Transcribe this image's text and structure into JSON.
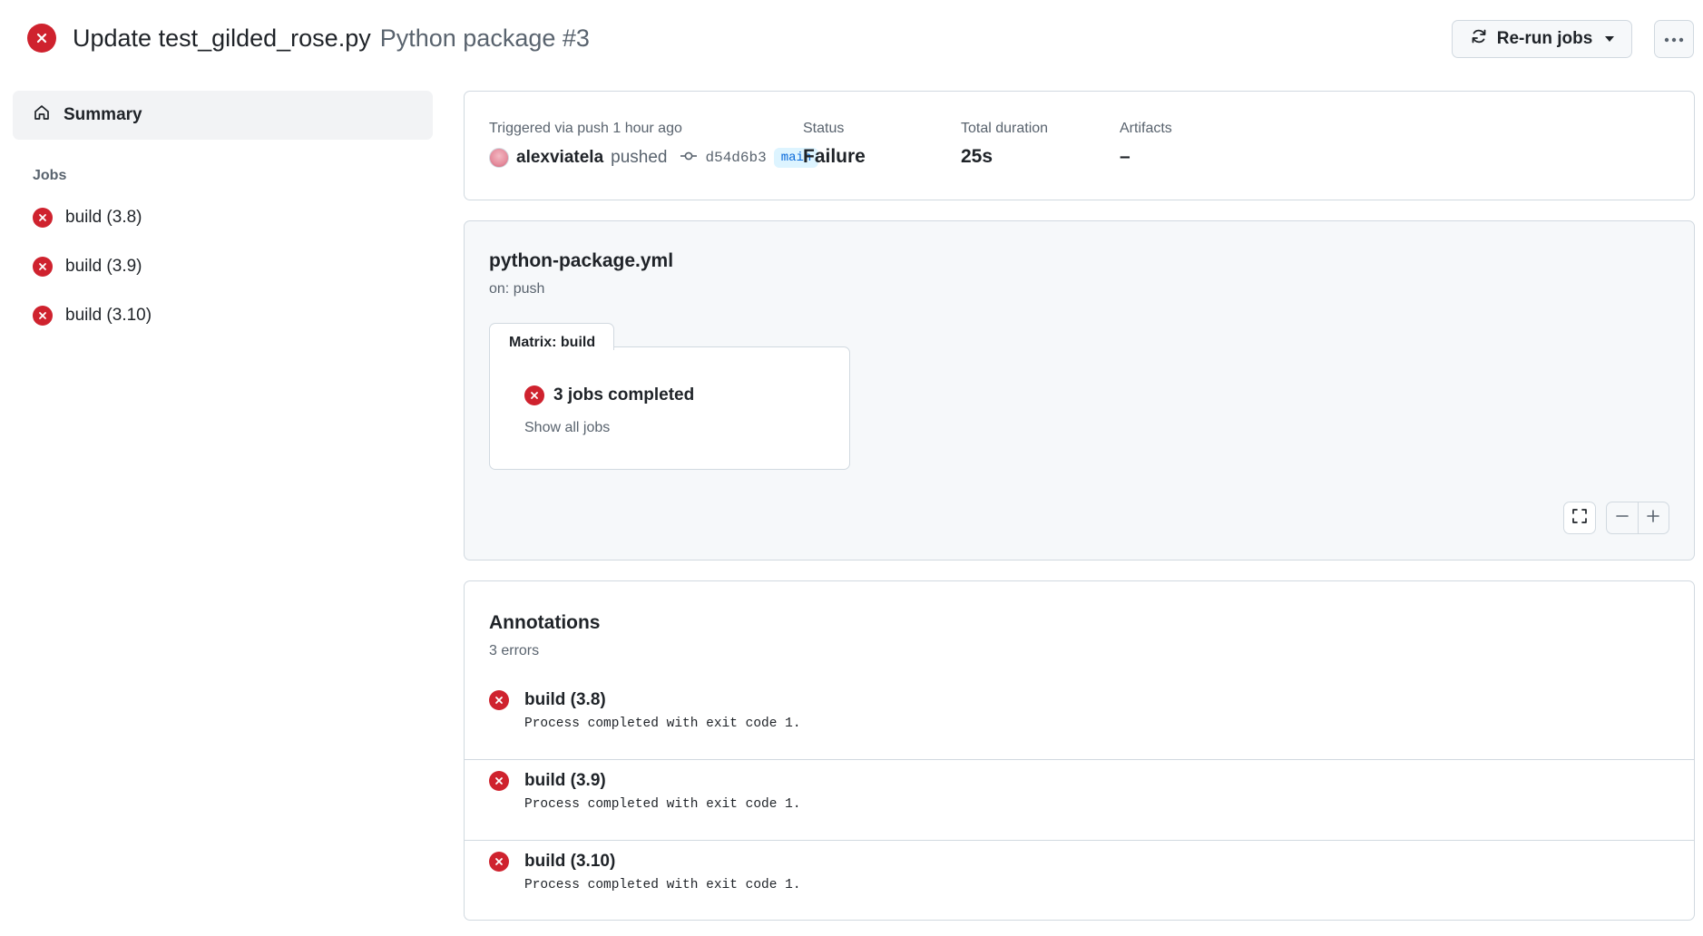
{
  "header": {
    "title": "Update test_gilded_rose.py",
    "subtitle": "Python package #3",
    "rerun_label": "Re-run jobs",
    "status_icon": "x-circle-fill-icon",
    "more_icon": "kebab-horizontal-icon"
  },
  "sidebar": {
    "summary_label": "Summary",
    "summary_icon": "home-icon",
    "jobs_heading": "Jobs",
    "jobs": [
      {
        "label": "build (3.8)",
        "status": "failure"
      },
      {
        "label": "build (3.9)",
        "status": "failure"
      },
      {
        "label": "build (3.10)",
        "status": "failure"
      }
    ]
  },
  "summary": {
    "trigger_label": "Triggered via push 1 hour ago",
    "user": "alexviatela",
    "action": "pushed",
    "commit": "d54d6b3",
    "branch": "main",
    "status_label": "Status",
    "status_value": "Failure",
    "duration_label": "Total duration",
    "duration_value": "25s",
    "artifacts_label": "Artifacts",
    "artifacts_value": "–"
  },
  "graph": {
    "workflow_file": "python-package.yml",
    "trigger": "on: push",
    "matrix_tab": "Matrix: build",
    "matrix_status": "3 jobs completed",
    "show_jobs": "Show all jobs"
  },
  "annotations": {
    "title": "Annotations",
    "count": "3 errors",
    "items": [
      {
        "job": "build (3.8)",
        "message": "Process completed with exit code 1."
      },
      {
        "job": "build (3.9)",
        "message": "Process completed with exit code 1."
      },
      {
        "job": "build (3.10)",
        "message": "Process completed with exit code 1."
      }
    ]
  },
  "colors": {
    "failure": "#cf222e",
    "accent": "#0969da",
    "border": "#d1d9e0",
    "muted_text": "#59636e"
  }
}
